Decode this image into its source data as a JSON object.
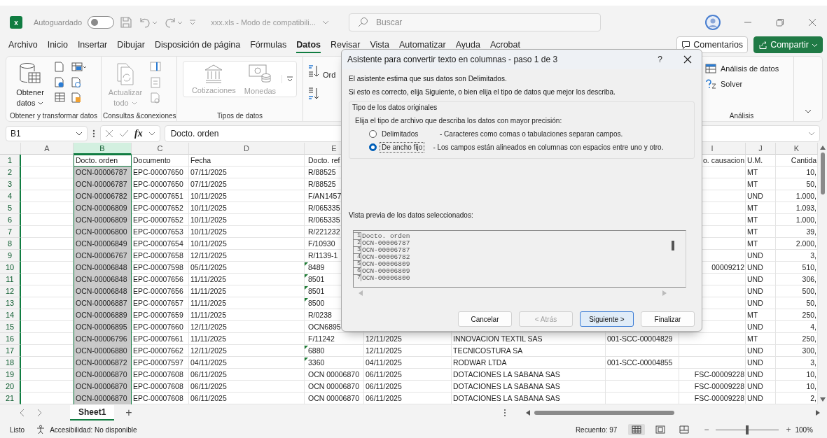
{
  "title_bar": {
    "logo_text": "x",
    "autosave_label": "Autoguardado",
    "autosave_on": false,
    "document_title": "xxx.xls  -  Modo de compatibili...",
    "search_placeholder": "Buscar"
  },
  "menu_tabs": [
    {
      "label": "Archivo",
      "selected": false
    },
    {
      "label": "Inicio",
      "selected": false
    },
    {
      "label": "Insertar",
      "selected": false
    },
    {
      "label": "Dibujar",
      "selected": false
    },
    {
      "label": "Disposición de página",
      "selected": false
    },
    {
      "label": "Fórmulas",
      "selected": false
    },
    {
      "label": "Datos",
      "selected": true
    },
    {
      "label": "Revisar",
      "selected": false
    },
    {
      "label": "Vista",
      "selected": false
    },
    {
      "label": "Automatizar",
      "selected": false
    },
    {
      "label": "Ayuda",
      "selected": false
    },
    {
      "label": "Acrobat",
      "selected": false
    }
  ],
  "comments_button": "Comentarios",
  "share_button": "Compartir",
  "ribbon": {
    "groups": [
      {
        "kind": "get",
        "label": "Obtener y transformar datos",
        "buttons": [
          {
            "label": "Obtener datos",
            "disabled": false
          }
        ]
      },
      {
        "kind": "queries",
        "label": "Consultas &conexiones",
        "buttons": [
          {
            "label": "Actualizar todo",
            "disabled": true
          }
        ]
      },
      {
        "kind": "types",
        "label": "Tipos de datos",
        "buttons": [
          {
            "label": "Cotizaciones",
            "disabled": true
          },
          {
            "label": "Monedas",
            "disabled": true
          }
        ]
      },
      {
        "kind": "sort",
        "buttons": [
          {
            "label": "Ord",
            "disabled": false
          }
        ]
      },
      {
        "kind": "analysis",
        "label": "Análisis",
        "buttons": [
          {
            "label": "Análisis de datos",
            "disabled": false
          },
          {
            "label": "Solver",
            "disabled": false
          }
        ]
      }
    ]
  },
  "formula_bar": {
    "name_box": "B1",
    "function_label": "fx",
    "formula": "Docto. orden"
  },
  "sheet": {
    "columns": [
      {
        "label": "A",
        "selected": false
      },
      {
        "label": "B",
        "selected": true
      },
      {
        "label": "C",
        "selected": false
      },
      {
        "label": "D",
        "selected": false
      },
      {
        "label": "E",
        "selected": false
      },
      null,
      null,
      null,
      {
        "label": "I",
        "selected": false
      },
      {
        "label": "J",
        "selected": false
      },
      {
        "label": "K",
        "selected": false
      }
    ],
    "rows": [
      {
        "n": "1",
        "flag": false,
        "cells": [
          "",
          "Docto. orden",
          "Documento",
          "Fecha",
          "Docto. ref",
          "",
          "",
          "",
          "o. causacion",
          "U.M.",
          "Cantida"
        ]
      },
      {
        "n": "2",
        "flag": false,
        "cells": [
          "",
          "OCN-00006787",
          "EPC-00007650",
          "07/11/2025",
          "R/88525",
          "",
          "",
          "",
          "",
          "MT",
          "10,"
        ]
      },
      {
        "n": "3",
        "flag": false,
        "cells": [
          "",
          "OCN-00006787",
          "EPC-00007650",
          "07/11/2025",
          "R/88525",
          "",
          "",
          "",
          "",
          "MT",
          "50,"
        ]
      },
      {
        "n": "4",
        "flag": false,
        "cells": [
          "",
          "OCN-00006782",
          "EPC-00007651",
          "10/11/2025",
          "F/AN1457",
          "",
          "",
          "",
          "",
          "UND",
          "1.000,"
        ]
      },
      {
        "n": "5",
        "flag": false,
        "cells": [
          "",
          "OCN-00006809",
          "EPC-00007652",
          "10/11/2025",
          "R/065335",
          "",
          "",
          "",
          "",
          "MT",
          "1.093,"
        ]
      },
      {
        "n": "6",
        "flag": false,
        "cells": [
          "",
          "OCN-00006809",
          "EPC-00007652",
          "10/11/2025",
          "R/065335",
          "",
          "",
          "",
          "",
          "MT",
          "1.000,"
        ]
      },
      {
        "n": "7",
        "flag": false,
        "cells": [
          "",
          "OCN-00006800",
          "EPC-00007653",
          "10/11/2025",
          "R/221232",
          "",
          "",
          "",
          "",
          "MT",
          "39,"
        ]
      },
      {
        "n": "8",
        "flag": false,
        "cells": [
          "",
          "OCN-00006849",
          "EPC-00007654",
          "10/11/2025",
          "F/10930",
          "",
          "",
          "",
          "",
          "MT",
          "2.000,"
        ]
      },
      {
        "n": "9",
        "flag": false,
        "cells": [
          "",
          "OCN-00006767",
          "EPC-00007658",
          "12/11/2025",
          "R/1139-1",
          "",
          "",
          "",
          "",
          "UND",
          "3,"
        ]
      },
      {
        "n": "10",
        "flag": true,
        "cells": [
          "",
          "OCN-00006848",
          "EPC-00007598",
          "05/11/2025",
          "8489",
          "",
          "",
          "",
          "00009212",
          "UND",
          "510,"
        ]
      },
      {
        "n": "11",
        "flag": true,
        "cells": [
          "",
          "OCN-00006848",
          "EPC-00007656",
          "11/11/2025",
          "8501",
          "",
          "",
          "",
          "",
          "UND",
          "306,"
        ]
      },
      {
        "n": "12",
        "flag": true,
        "cells": [
          "",
          "OCN-00006848",
          "EPC-00007656",
          "11/11/2025",
          "8501",
          "",
          "",
          "",
          "",
          "UND",
          "500,"
        ]
      },
      {
        "n": "13",
        "flag": true,
        "cells": [
          "",
          "OCN-00006887",
          "EPC-00007657",
          "11/11/2025",
          "8500",
          "",
          "",
          "",
          "",
          "UND",
          "50,"
        ]
      },
      {
        "n": "14",
        "flag": false,
        "cells": [
          "",
          "OCN-00006889",
          "EPC-00007659",
          "11/11/2025",
          "R/0238",
          "",
          "",
          "",
          "",
          "MT",
          "250,"
        ]
      },
      {
        "n": "15",
        "flag": false,
        "cells": [
          "",
          "OCN-00006895",
          "EPC-00007660",
          "12/11/2025",
          "OCN6895",
          "",
          "",
          "",
          "",
          "UND",
          "4,"
        ]
      },
      {
        "n": "16",
        "flag": false,
        "cells": [
          "",
          "OCN-00006796",
          "EPC-00007661",
          "11/11/2025",
          "F/11242",
          "12/11/2025",
          "INNOVACION TEXTIL SAS",
          "001-SCC-00004829",
          "",
          "MT",
          "250,"
        ]
      },
      {
        "n": "17",
        "flag": true,
        "cells": [
          "",
          "OCN-00006880",
          "EPC-00007662",
          "12/11/2025",
          "6880",
          "12/11/2025",
          "TECNICOSTURA SA",
          "",
          "",
          "UND",
          "300,"
        ]
      },
      {
        "n": "18",
        "flag": true,
        "cells": [
          "",
          "OCN-00006872",
          "EPC-00007597",
          "04/11/2025",
          "3360",
          "04/11/2025",
          "RODWAR LTDA",
          "001-SCC-00004855",
          "",
          "UND",
          "3,"
        ]
      },
      {
        "n": "19",
        "flag": false,
        "cells": [
          "",
          "OCN-00006870",
          "EPC-00007608",
          "06/11/2025",
          "OCN 00006870",
          "06/11/2025",
          "DOTACIONES LA SABANA SAS",
          "",
          "FSC-00009228",
          "UND",
          "10,"
        ]
      },
      {
        "n": "20",
        "flag": false,
        "cells": [
          "",
          "OCN-00006870",
          "EPC-00007608",
          "06/11/2025",
          "OCN 00006870",
          "06/11/2025",
          "DOTACIONES LA SABANA SAS",
          "",
          "FSC-00009228",
          "UND",
          "10,"
        ]
      },
      {
        "n": "21",
        "flag": false,
        "cells": [
          "",
          "OCN-00006870",
          "EPC-00007608",
          "06/11/2025",
          "OCN 00006870",
          "06/11/2025",
          "DOTACIONES LA SABANA SAS",
          "",
          "FSC-00009228",
          "UND",
          "2,"
        ]
      }
    ]
  },
  "sheet_tabs": [
    {
      "label": "Sheet1",
      "selected": true
    }
  ],
  "add_sheet": "+",
  "status": {
    "ready": "Listo",
    "accessibility": "Accesibilidad: No disponible",
    "count": "Recuento: 97",
    "views": [
      {
        "kind": "normal",
        "selected": true
      },
      {
        "kind": "page_layout",
        "selected": false
      },
      {
        "kind": "page_break",
        "selected": false
      }
    ],
    "zoom_out": "−",
    "zoom_in": "+",
    "zoom": {
      "level": 0.5,
      "reading": "100%"
    }
  },
  "dialog": {
    "title": "Asistente para convertir texto en columnas - paso 1 de 3",
    "help": "?",
    "intro": [
      "El asistente estima que sus datos son Delimitados.",
      "Si esto es correcto, elija Siguiente, o bien elija el tipo de datos que mejor los describa."
    ],
    "group_title": "Tipo de los datos originales",
    "prompt": "Elija el tipo de archivo que describa los datos con mayor precisión:",
    "options": [
      {
        "label": "Delimitados",
        "description": "- Caracteres como comas o tabulaciones separan campos.",
        "selected": false
      },
      {
        "label": "De ancho fijo",
        "description": "- Los campos están alineados en columnas con espacios entre uno y otro.",
        "selected": true
      }
    ],
    "preview_label": "Vista previa de los datos seleccionados:",
    "preview": [
      {
        "n": "1",
        "text": "Docto. orden"
      },
      {
        "n": "2",
        "text": "OCN-00006787"
      },
      {
        "n": "3",
        "text": "OCN-00006787"
      },
      {
        "n": "4",
        "text": "OCN-00006782"
      },
      {
        "n": "5",
        "text": "OCN-00006809"
      },
      {
        "n": "6",
        "text": "OCN-00006809"
      },
      {
        "n": "7",
        "text": "OCN-00006800"
      }
    ],
    "buttons": [
      {
        "label": "Cancelar",
        "disabled": false,
        "default": false
      },
      {
        "label": "< Atrás",
        "disabled": true,
        "default": false
      },
      {
        "label": "Siguiente >",
        "disabled": false,
        "default": true
      },
      {
        "label": "Finalizar",
        "disabled": false,
        "default": false
      }
    ]
  }
}
